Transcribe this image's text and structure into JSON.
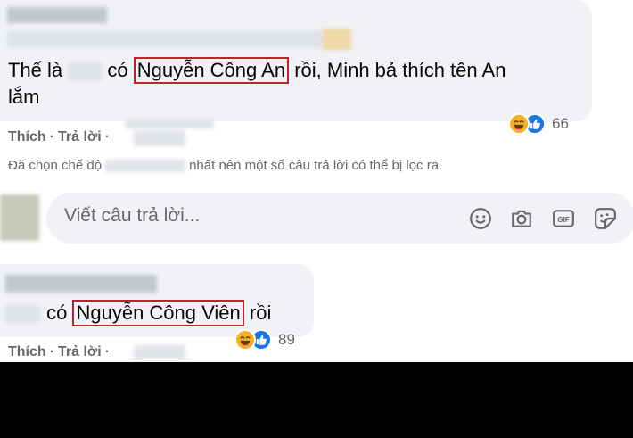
{
  "comment1": {
    "text_before": "Thế là ",
    "text_mid": " có ",
    "highlight": "Nguyễn Công An",
    "text_after": " rồi, Minh bả thích tên An",
    "line2": "lắm",
    "reaction_count": "66"
  },
  "actions1": {
    "like": "Thích",
    "separator": "·",
    "reply": "Trả lời",
    "separator2": "·"
  },
  "filter_notice": "Đã chọn chế độ",
  "filter_notice_tail": "nhất nên một số câu trả lời có thể bị lọc ra.",
  "reply_box": {
    "placeholder": "Viết câu trả lời...",
    "icons": [
      "emoji-icon",
      "camera-icon",
      "gif-icon",
      "sticker-icon"
    ]
  },
  "comment2": {
    "text_mid": " có ",
    "highlight": "Nguyễn Công Viên",
    "text_after": " rồi",
    "reaction_count": "89"
  },
  "actions2": {
    "like": "Thích",
    "separator": "·",
    "reply": "Trả lời",
    "separator2": "·"
  },
  "colors": {
    "bubble": "#f0f2f5",
    "highlight_border": "#c0212b",
    "secondary_text": "#65676b",
    "like_blue": "#1b74e4",
    "haha_yellow": "#f7b125"
  }
}
